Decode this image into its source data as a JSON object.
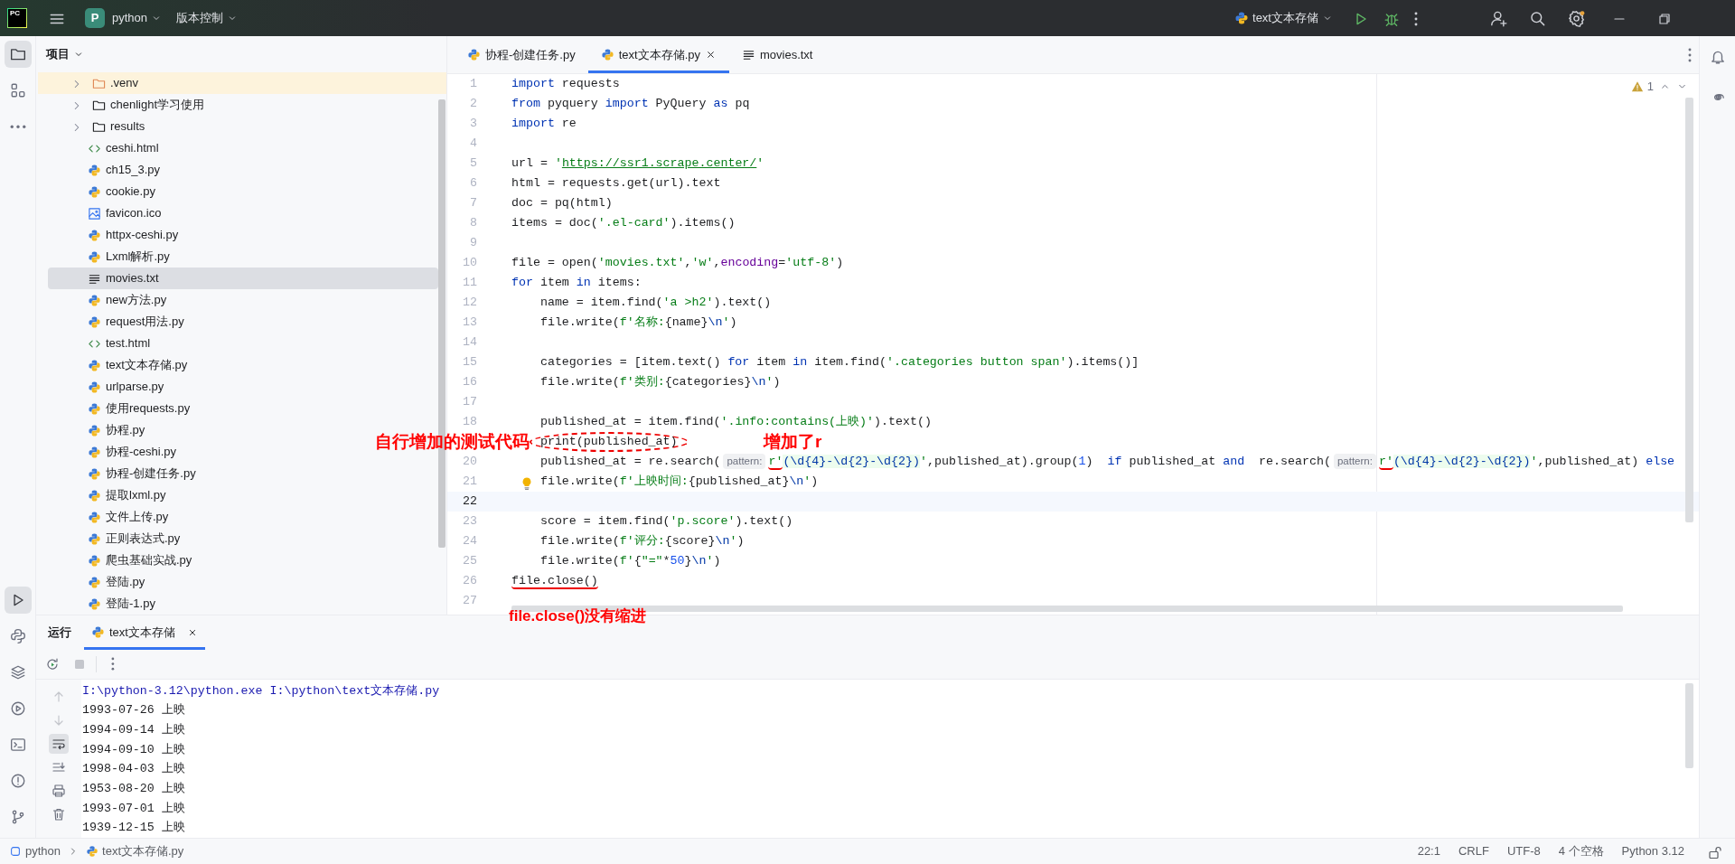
{
  "title_bar": {
    "logo_text": "PC",
    "project_badge": "P",
    "project_name": "python",
    "vcs": "版本控制",
    "run_config": "text文本存储"
  },
  "left_toolbar": {
    "top": [
      {
        "kind": "project",
        "selected": true
      },
      {
        "kind": "structure",
        "selected": false
      },
      {
        "kind": "more",
        "selected": false
      }
    ],
    "bottom": [
      {
        "kind": "run",
        "selected": true
      },
      {
        "kind": "python-console",
        "selected": false
      },
      {
        "kind": "layers",
        "selected": false
      },
      {
        "kind": "services",
        "selected": false
      },
      {
        "kind": "terminal",
        "selected": false
      },
      {
        "kind": "problems",
        "selected": false
      },
      {
        "kind": "git",
        "selected": false
      }
    ]
  },
  "project_panel": {
    "title": "项目",
    "items": [
      {
        "label": ".venv",
        "kind": "excluded-folder",
        "expanded": false,
        "selected": false
      },
      {
        "label": "chenlight学习使用",
        "kind": "folder",
        "expanded": false,
        "selected": false
      },
      {
        "label": "results",
        "kind": "folder",
        "expanded": false,
        "selected": false
      },
      {
        "label": "ceshi.html",
        "kind": "html",
        "selected": false
      },
      {
        "label": "ch15_3.py",
        "kind": "py",
        "selected": false
      },
      {
        "label": "cookie.py",
        "kind": "py",
        "selected": false
      },
      {
        "label": "favicon.ico",
        "kind": "image",
        "selected": false
      },
      {
        "label": "httpx-ceshi.py",
        "kind": "py",
        "selected": false
      },
      {
        "label": "Lxml解析.py",
        "kind": "py",
        "selected": false
      },
      {
        "label": "movies.txt",
        "kind": "txt",
        "selected": true
      },
      {
        "label": "new方法.py",
        "kind": "py",
        "selected": false
      },
      {
        "label": "request用法.py",
        "kind": "py",
        "selected": false
      },
      {
        "label": "test.html",
        "kind": "html",
        "selected": false
      },
      {
        "label": "text文本存储.py",
        "kind": "py",
        "selected": false
      },
      {
        "label": "urlparse.py",
        "kind": "py",
        "selected": false
      },
      {
        "label": "使用requests.py",
        "kind": "py",
        "selected": false
      },
      {
        "label": "协程.py",
        "kind": "py",
        "selected": false
      },
      {
        "label": "协程-ceshi.py",
        "kind": "py",
        "selected": false
      },
      {
        "label": "协程-创建任务.py",
        "kind": "py",
        "selected": false
      },
      {
        "label": "提取lxml.py",
        "kind": "py",
        "selected": false
      },
      {
        "label": "文件上传.py",
        "kind": "py",
        "selected": false
      },
      {
        "label": "正则表达式.py",
        "kind": "py",
        "selected": false
      },
      {
        "label": "爬虫基础实战.py",
        "kind": "py",
        "selected": false
      },
      {
        "label": "登陆.py",
        "kind": "py",
        "selected": false
      },
      {
        "label": "登陆-1.py",
        "kind": "py",
        "selected": false
      }
    ]
  },
  "editor": {
    "tabs": [
      {
        "label": "协程-创建任务.py",
        "kind": "py",
        "selected": false
      },
      {
        "label": "text文本存储.py",
        "kind": "py",
        "selected": true
      },
      {
        "label": "movies.txt",
        "kind": "txt",
        "selected": false
      }
    ],
    "warning_count": "1",
    "lines": [
      {
        "n": "1",
        "current": false,
        "segs": [
          {
            "kind": "keyword",
            "text": "import"
          },
          {
            "text": " requests"
          }
        ]
      },
      {
        "n": "2",
        "current": false,
        "segs": [
          {
            "kind": "keyword",
            "text": "from"
          },
          {
            "text": " pyquery "
          },
          {
            "kind": "keyword",
            "text": "import"
          },
          {
            "text": " PyQuery "
          },
          {
            "kind": "keyword",
            "text": "as"
          },
          {
            "text": " pq"
          }
        ]
      },
      {
        "n": "3",
        "current": false,
        "segs": [
          {
            "kind": "keyword",
            "text": "import"
          },
          {
            "text": " re"
          }
        ]
      },
      {
        "n": "4",
        "current": false
      },
      {
        "n": "5",
        "current": false,
        "segs": [
          {
            "text": "url = "
          },
          {
            "kind": "string",
            "text": "'"
          },
          {
            "kind": "url",
            "text": "https://ssr1.scrape.center/"
          },
          {
            "kind": "string",
            "text": "'"
          }
        ]
      },
      {
        "n": "6",
        "current": false,
        "segs": [
          {
            "text": "html = requests.get(url).text"
          }
        ]
      },
      {
        "n": "7",
        "current": false,
        "segs": [
          {
            "text": "doc = pq(html)"
          }
        ]
      },
      {
        "n": "8",
        "current": false,
        "segs": [
          {
            "text": "items = doc("
          },
          {
            "kind": "string",
            "text": "'.el-card'"
          },
          {
            "text": ").items()"
          }
        ]
      },
      {
        "n": "9",
        "current": false
      },
      {
        "n": "10",
        "current": false,
        "segs": [
          {
            "text": "file = open("
          },
          {
            "kind": "string",
            "text": "'movies.txt'"
          },
          {
            "text": ","
          },
          {
            "kind": "string",
            "text": "'w'"
          },
          {
            "text": ","
          },
          {
            "kind": "argument",
            "text": "encoding"
          },
          {
            "text": "="
          },
          {
            "kind": "string",
            "text": "'utf-8'"
          },
          {
            "text": ")"
          }
        ]
      },
      {
        "n": "11",
        "current": false,
        "segs": [
          {
            "kind": "keyword",
            "text": "for"
          },
          {
            "text": " item "
          },
          {
            "kind": "keyword",
            "text": "in"
          },
          {
            "text": " items:"
          }
        ]
      },
      {
        "n": "12",
        "current": false,
        "segs": [
          {
            "text": "    name = item.find("
          },
          {
            "kind": "string",
            "text": "'a >h2'"
          },
          {
            "text": ").text()"
          }
        ]
      },
      {
        "n": "13",
        "current": false,
        "segs": [
          {
            "text": "    file.write("
          },
          {
            "kind": "string",
            "text": "f'名称:"
          },
          {
            "text": "{name}"
          },
          {
            "kind": "escape",
            "text": "\\n"
          },
          {
            "kind": "string",
            "text": "'"
          },
          {
            "text": ")"
          }
        ]
      },
      {
        "n": "14",
        "current": false
      },
      {
        "n": "15",
        "current": false,
        "segs": [
          {
            "text": "    categories = [item.text() "
          },
          {
            "kind": "keyword",
            "text": "for"
          },
          {
            "text": " item "
          },
          {
            "kind": "keyword",
            "text": "in"
          },
          {
            "text": " item.find("
          },
          {
            "kind": "string",
            "text": "'.categories button span'"
          },
          {
            "text": ").items()]"
          }
        ]
      },
      {
        "n": "16",
        "current": false,
        "segs": [
          {
            "text": "    file.write("
          },
          {
            "kind": "string",
            "text": "f'类别:"
          },
          {
            "text": "{categories}"
          },
          {
            "kind": "escape",
            "text": "\\n"
          },
          {
            "kind": "string",
            "text": "'"
          },
          {
            "text": ")"
          }
        ]
      },
      {
        "n": "17",
        "current": false
      },
      {
        "n": "18",
        "current": false,
        "segs": [
          {
            "text": "    published_at = item.find("
          },
          {
            "kind": "string",
            "text": "'.info:contains(上映)'"
          },
          {
            "text": ").text()"
          }
        ]
      },
      {
        "current": false,
        "segs": [
          {
            "text": "    print(published_at)",
            "circled": true
          }
        ]
      },
      {
        "n": "20",
        "current": false,
        "segs": [
          {
            "text": "    published_at = re.search("
          },
          {
            "kind": "hint",
            "text": "pattern:"
          },
          {
            "kind": "string",
            "text": "r'",
            "underlined": true
          },
          {
            "kind": "regex",
            "text": "(\\d{4}-\\d{2}-\\d{2})"
          },
          {
            "kind": "string",
            "text": "'"
          },
          {
            "text": ",published_at).group("
          },
          {
            "kind": "number",
            "text": "1"
          },
          {
            "text": ")  "
          },
          {
            "kind": "keyword",
            "text": "if"
          },
          {
            "text": " published_at "
          },
          {
            "kind": "keyword",
            "text": "and"
          },
          {
            "text": "  re.search("
          },
          {
            "kind": "hint",
            "text": "pattern:"
          },
          {
            "kind": "string",
            "text": "r'",
            "underlined": true
          },
          {
            "kind": "regex",
            "text": "(\\d{4}-\\d{2}-\\d{2})"
          },
          {
            "kind": "string",
            "text": "'"
          },
          {
            "text": ",published_at) "
          },
          {
            "kind": "keyword",
            "text": "else"
          }
        ]
      },
      {
        "n": "21",
        "current": false,
        "bulb": true,
        "segs": [
          {
            "text": "    file.write("
          },
          {
            "kind": "string",
            "text": "f'上映时间:"
          },
          {
            "text": "{published_at}"
          },
          {
            "kind": "escape",
            "text": "\\n"
          },
          {
            "kind": "string",
            "text": "'"
          },
          {
            "text": ")"
          }
        ]
      },
      {
        "n": "22",
        "current": true
      },
      {
        "n": "23",
        "current": false,
        "segs": [
          {
            "text": "    score = item.find("
          },
          {
            "kind": "string",
            "text": "'p.score'"
          },
          {
            "text": ").text()"
          }
        ]
      },
      {
        "n": "24",
        "current": false,
        "segs": [
          {
            "text": "    file.write("
          },
          {
            "kind": "string",
            "text": "f'评分:"
          },
          {
            "text": "{score}"
          },
          {
            "kind": "escape",
            "text": "\\n"
          },
          {
            "kind": "string",
            "text": "'"
          },
          {
            "text": ")"
          }
        ]
      },
      {
        "n": "25",
        "current": false,
        "segs": [
          {
            "text": "    file.write("
          },
          {
            "kind": "string",
            "text": "f'"
          },
          {
            "text": "{"
          },
          {
            "kind": "string",
            "text": "\"=\""
          },
          {
            "text": "*"
          },
          {
            "kind": "number",
            "text": "50"
          },
          {
            "text": "}"
          },
          {
            "kind": "escape",
            "text": "\\n"
          },
          {
            "kind": "string",
            "text": "'"
          },
          {
            "text": ")"
          }
        ]
      },
      {
        "n": "26",
        "current": false,
        "segs": [
          {
            "text": "file.close()",
            "underlined": true
          }
        ]
      },
      {
        "n": "27",
        "current": false
      }
    ]
  },
  "annotations": [
    {
      "text": "自行增加的测试代码"
    },
    {
      "text": "增加了r"
    },
    {
      "text": "file.close()没有缩进"
    }
  ],
  "run_panel": {
    "title": "运行",
    "tabs": [
      {
        "label": "text文本存储",
        "selected": true
      }
    ],
    "side_tools": [
      {
        "kind": "up",
        "selected": false
      },
      {
        "kind": "down",
        "selected": false
      },
      {
        "kind": "wrap",
        "selected": true
      },
      {
        "kind": "scroll-end",
        "selected": false
      },
      {
        "kind": "print",
        "selected": false
      },
      {
        "kind": "trash",
        "selected": false
      }
    ],
    "output": [
      {
        "kind": "command",
        "text": "I:\\python-3.12\\python.exe I:\\python\\text文本存储.py"
      },
      {
        "kind": "stdout",
        "text": "1993-07-26 上映"
      },
      {
        "kind": "stdout",
        "text": "1994-09-14 上映"
      },
      {
        "kind": "stdout",
        "text": "1994-09-10 上映"
      },
      {
        "kind": "stdout",
        "text": "1998-04-03 上映"
      },
      {
        "kind": "stdout",
        "text": "1953-08-20 上映"
      },
      {
        "kind": "stdout",
        "text": "1993-07-01 上映"
      },
      {
        "kind": "stdout",
        "text": "1939-12-15 上映"
      }
    ]
  },
  "status_bar": {
    "breadcrumbs": [
      "python",
      "text文本存储.py"
    ],
    "items": [
      "22:1",
      "CRLF",
      "UTF-8",
      "4 个空格",
      "Python 3.12"
    ]
  }
}
